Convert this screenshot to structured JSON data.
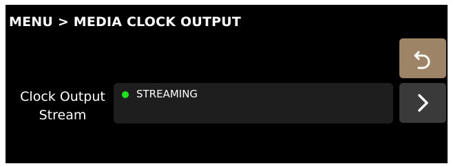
{
  "header": {
    "title": "MENU > MEDIA CLOCK OUTPUT"
  },
  "actions": {
    "back_icon": "undo-arrow-icon",
    "next_icon": "chevron-right-icon"
  },
  "setting": {
    "label_line1": "Clock Output",
    "label_line2": "Stream",
    "value": "STREAMING",
    "status_color": "#1fe01f"
  },
  "colors": {
    "background": "#000000",
    "back_button": "#9e8466",
    "next_button": "#3a3a3a",
    "value_box": "#1e1e1e"
  }
}
